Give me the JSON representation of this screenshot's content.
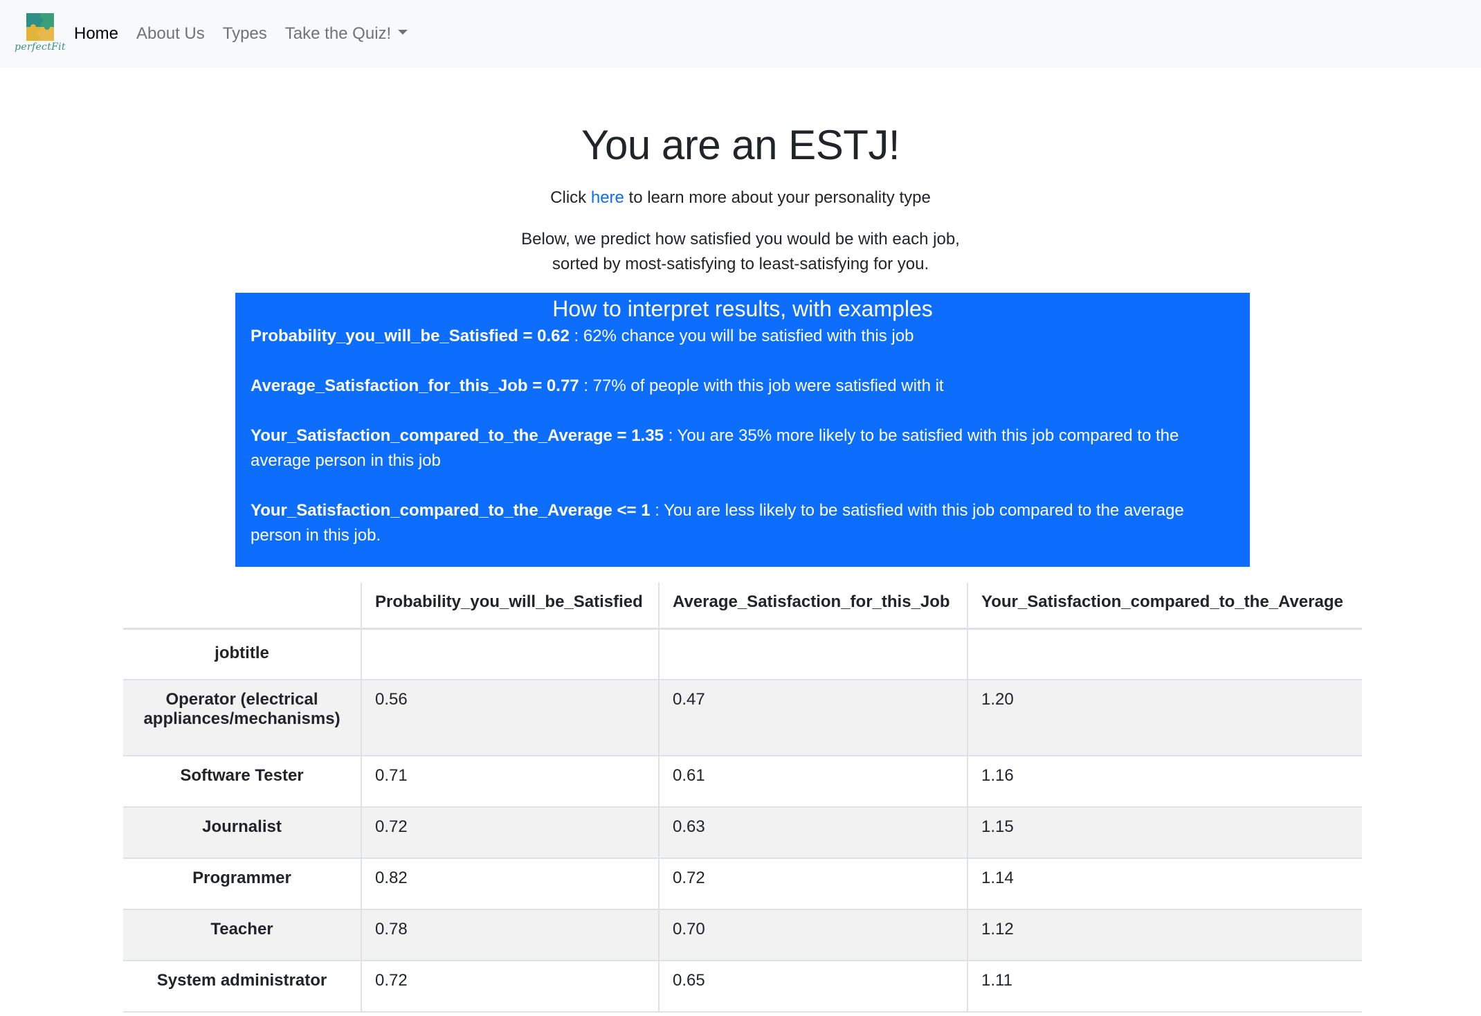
{
  "nav": {
    "logo_text": "perfectFit",
    "items": [
      {
        "label": "Home",
        "active": true
      },
      {
        "label": "About Us",
        "active": false
      },
      {
        "label": "Types",
        "active": false
      },
      {
        "label": "Take the Quiz!",
        "active": false,
        "dropdown": true
      }
    ]
  },
  "header": {
    "title": "You are an ESTJ!",
    "click_prefix": "Click ",
    "click_link": "here",
    "click_suffix": " to learn more about your personality type",
    "desc_line1": "Below, we predict how satisfied you would be with each job,",
    "desc_line2": "sorted by most-satisfying to least-satisfying for you."
  },
  "info": {
    "heading": "How to interpret results, with examples",
    "items": [
      {
        "bold": "Probability_you_will_be_Satisfied = 0.62",
        "text": " : 62% chance you will be satisfied with this job"
      },
      {
        "bold": "Average_Satisfaction_for_this_Job = 0.77",
        "text": " : 77% of people with this job were satisfied with it"
      },
      {
        "bold": "Your_Satisfaction_compared_to_the_Average = 1.35",
        "text": " : You are 35% more likely to be satisfied with this job compared to the average person in this job"
      },
      {
        "bold": "Your_Satisfaction_compared_to_the_Average <= 1",
        "text": " : You are less likely to be satisfied with this job compared to the average person in this job."
      }
    ]
  },
  "table": {
    "columns": [
      "Probability_you_will_be_Satisfied",
      "Average_Satisfaction_for_this_Job",
      "Your_Satisfaction_compared_to_the_Average"
    ],
    "index_label": "jobtitle",
    "rows": [
      {
        "job": "Operator (electrical appliances/mechanisms)",
        "values": [
          "0.56",
          "0.47",
          "1.20"
        ]
      },
      {
        "job": "Software Tester",
        "values": [
          "0.71",
          "0.61",
          "1.16"
        ]
      },
      {
        "job": "Journalist",
        "values": [
          "0.72",
          "0.63",
          "1.15"
        ]
      },
      {
        "job": "Programmer",
        "values": [
          "0.82",
          "0.72",
          "1.14"
        ]
      },
      {
        "job": "Teacher",
        "values": [
          "0.78",
          "0.70",
          "1.12"
        ]
      },
      {
        "job": "System administrator",
        "values": [
          "0.72",
          "0.65",
          "1.11"
        ]
      }
    ]
  },
  "colors": {
    "navbar_bg": "#f8f9fa",
    "info_bg": "#0d6efd",
    "link": "#0d6efd",
    "stripe": "#f2f2f2"
  }
}
